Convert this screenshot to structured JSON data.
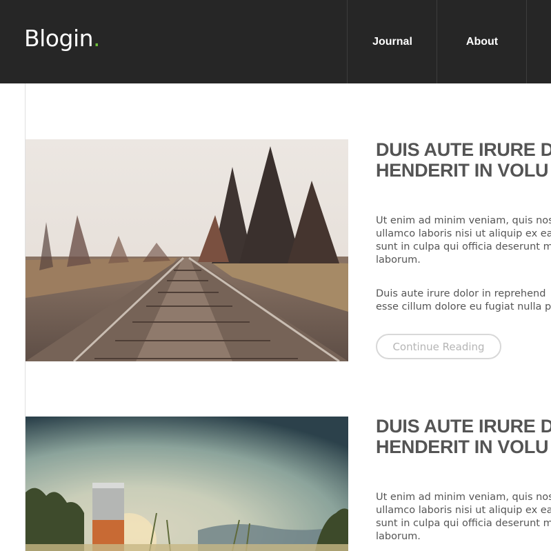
{
  "header": {
    "logo_text": "Blogin",
    "logo_dot": ".",
    "nav": [
      {
        "label": "Journal"
      },
      {
        "label": "About"
      }
    ]
  },
  "posts": [
    {
      "title_line1": "DUIS AUTE IRURE D",
      "title_line2": "HENDERIT IN VOLU",
      "para1": "Ut enim ad minim veniam, quis nos\nullamco laboris nisi ut aliquip ex ea\nsunt in culpa qui officia deserunt m\nlaborum.",
      "para2": "Duis aute irure dolor in reprehend\nesse cillum dolore eu fugiat nulla p",
      "button_label": "Continue Reading"
    },
    {
      "title_line1": "DUIS AUTE IRURE D",
      "title_line2": "HENDERIT IN VOLU",
      "para1": "Ut enim ad minim veniam, quis nos\nullamco laboris nisi ut aliquip ex ea\nsunt in culpa qui officia deserunt m\nlaborum."
    }
  ],
  "colors": {
    "header_bg": "#262626",
    "logo_accent": "#6ec13a",
    "title_text": "#545454",
    "button_border": "#d8d8d8"
  }
}
